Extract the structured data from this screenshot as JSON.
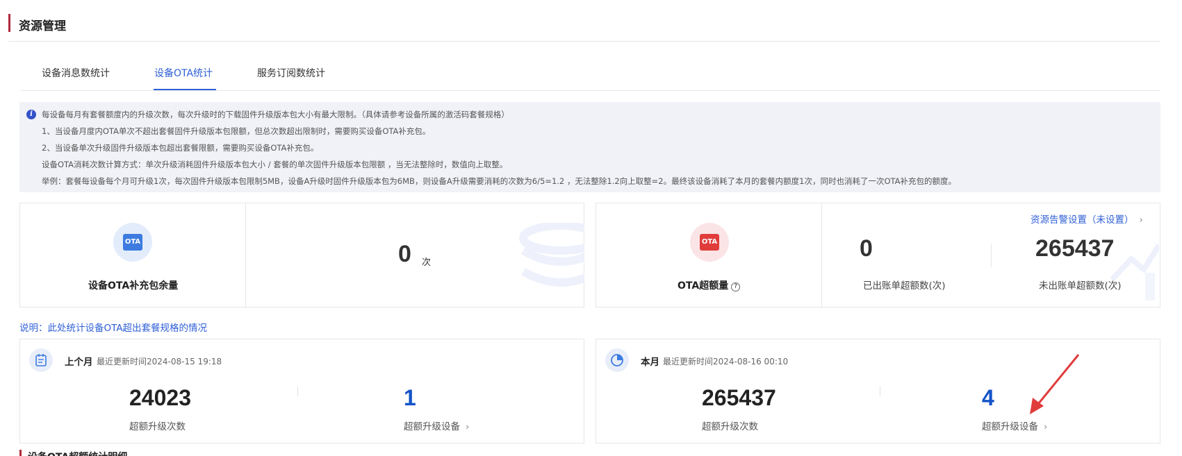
{
  "page": {
    "title": "资源管理"
  },
  "tabs": [
    {
      "label": "设备消息数统计"
    },
    {
      "label": "设备OTA统计",
      "active": true
    },
    {
      "label": "服务订阅数统计"
    }
  ],
  "notice": {
    "lines": [
      "每设备每月有套餐额度内的升级次数，每次升级时的下载固件升级版本包大小有最大限制。（具体请参考设备所属的激活码套餐规格）",
      "1、当设备月度内OTA单次不超出套餐固件升级版本包限额，但总次数超出限制时，需要购买设备OTA补充包。",
      "2、当设备单次升级固件升级版本包超出套餐限额，需要购买设备OTA补充包。",
      "设备OTA消耗次数计算方式：单次升级消耗固件升级版本包大小 / 套餐的单次固件升级版本包限额 ，当无法整除时，数值向上取整。",
      "举例：套餐每设备每个月可升级1次，每次固件升级版本包限制5MB，设备A升级时固件升级版本包为6MB，则设备A升级需要消耗的次数为6/5=1.2 ，无法整除1.2向上取整=2。最终该设备消耗了本月的套餐内额度1次，同时也消耗了一次OTA补充包的额度。"
    ]
  },
  "supplement_card": {
    "icon_text": "OTA",
    "label": "设备OTA补充包余量",
    "value": "0",
    "unit": "次"
  },
  "overage_card": {
    "icon_text": "OTA",
    "label": "OTA超额量",
    "help_icon": "?",
    "alert_link": "资源告警设置（未设置）",
    "billed_value": "0",
    "billed_label": "已出账单超额数(次)",
    "unbilled_value": "265437",
    "unbilled_label": "未出账单超额数(次)"
  },
  "description": "说明：此处统计设备OTA超出套餐规格的情况",
  "last_month": {
    "title": "上个月",
    "updated": "最近更新时间2024-08-15 19:18",
    "upgrade_count": "24023",
    "upgrade_count_label": "超额升级次数",
    "device_count": "1",
    "device_count_label": "超额升级设备"
  },
  "this_month": {
    "title": "本月",
    "updated": "最近更新时间2024-08-16 00:10",
    "upgrade_count": "265437",
    "upgrade_count_label": "超额升级次数",
    "device_count": "4",
    "device_count_label": "超额升级设备"
  },
  "bottom_section": {
    "title": "设备OTA超额统计明细"
  },
  "colors": {
    "accent_red": "#b1283a",
    "primary_blue": "#2f5fd6",
    "number_blue": "#1453c8"
  }
}
